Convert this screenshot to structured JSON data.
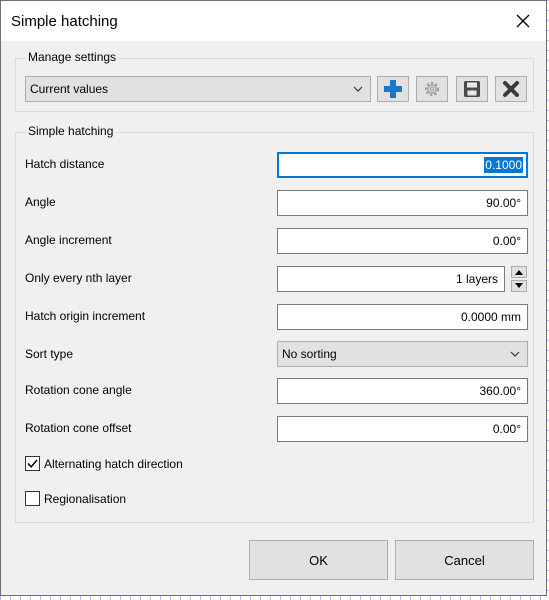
{
  "window": {
    "title": "Simple hatching"
  },
  "manage": {
    "group_title": "Manage settings",
    "preset_value": "Current values",
    "tools": [
      "add-icon",
      "gear-icon",
      "save-icon",
      "delete-icon"
    ]
  },
  "hatch": {
    "group_title": "Simple hatching",
    "hatch_distance": {
      "label": "Hatch distance",
      "value": "0.1000"
    },
    "angle": {
      "label": "Angle",
      "value": "90.00°"
    },
    "angle_increment": {
      "label": "Angle increment",
      "value": "0.00°"
    },
    "nth_layer": {
      "label": "Only every nth layer",
      "value": "1 layers"
    },
    "origin_increment": {
      "label": "Hatch origin increment",
      "value": "0.0000 mm"
    },
    "sort_type": {
      "label": "Sort type",
      "value": "No sorting"
    },
    "cone_angle": {
      "label": "Rotation cone angle",
      "value": "360.00°"
    },
    "cone_offset": {
      "label": "Rotation cone offset",
      "value": "0.00°"
    },
    "alternating": {
      "label": "Alternating hatch direction",
      "checked": true
    },
    "regionalisation": {
      "label": "Regionalisation",
      "checked": false
    }
  },
  "buttons": {
    "ok": "OK",
    "cancel": "Cancel"
  },
  "colors": {
    "accent": "#0078d7",
    "add_icon": "#1b78c8",
    "dialog_bg": "#f0f0f0"
  }
}
